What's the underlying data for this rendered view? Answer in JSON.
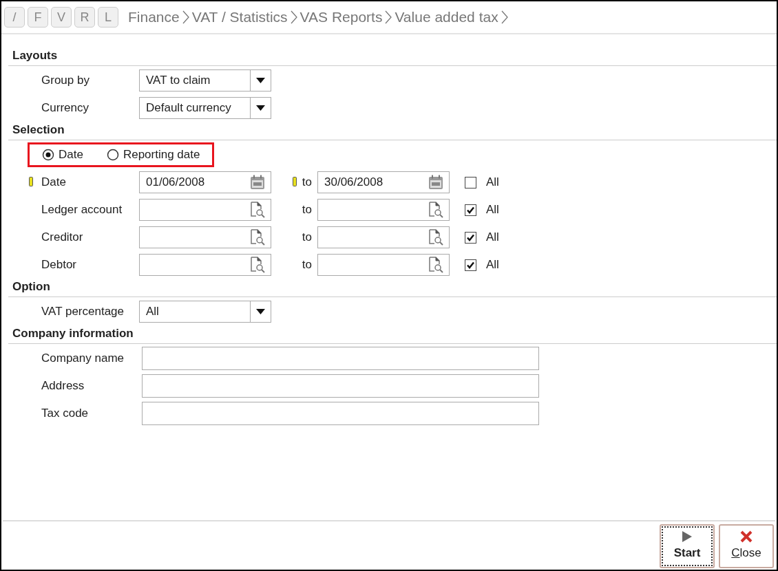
{
  "nav_buttons": [
    "/",
    "F",
    "V",
    "R",
    "L"
  ],
  "breadcrumb": [
    "Finance",
    "VAT / Statistics",
    "VAS Reports",
    "Value added tax"
  ],
  "sections": [
    {
      "title": "Layouts",
      "rows": [
        {
          "kind": "dropdown",
          "label": "Group by",
          "value": "VAT to claim"
        },
        {
          "kind": "dropdown",
          "label": "Currency",
          "value": "Default currency"
        }
      ]
    },
    {
      "title": "Selection",
      "rows": [
        {
          "kind": "radios",
          "highlighted": true,
          "options": [
            {
              "label": "Date",
              "selected": true
            },
            {
              "label": "Reporting date",
              "selected": false
            }
          ]
        },
        {
          "kind": "date_range",
          "label": "Date",
          "required": true,
          "from": "01/06/2008",
          "to_label": "to",
          "to_required": true,
          "to": "30/06/2008",
          "all_label": "All",
          "all_checked": false
        },
        {
          "kind": "lookup_range",
          "label": "Ledger account",
          "required": false,
          "to_label": "to",
          "to_required": false,
          "all_label": "All",
          "all_checked": true
        },
        {
          "kind": "lookup_range",
          "label": "Creditor",
          "required": false,
          "to_label": "to",
          "to_required": false,
          "all_label": "All",
          "all_checked": true
        },
        {
          "kind": "lookup_range",
          "label": "Debtor",
          "required": false,
          "to_label": "to",
          "to_required": false,
          "all_label": "All",
          "all_checked": true
        }
      ]
    },
    {
      "title": "Option",
      "rows": [
        {
          "kind": "dropdown",
          "label": "VAT percentage",
          "value": "All"
        }
      ]
    },
    {
      "title": "Company information",
      "rows": [
        {
          "kind": "text",
          "label": "Company name"
        },
        {
          "kind": "text",
          "label": "Address"
        },
        {
          "kind": "text",
          "label": "Tax code"
        }
      ]
    }
  ],
  "buttons": [
    {
      "kind": "start",
      "label": "Start",
      "focused": true,
      "mnemonic": false
    },
    {
      "kind": "close",
      "label": "Close",
      "focused": false,
      "mnemonic": true
    }
  ]
}
